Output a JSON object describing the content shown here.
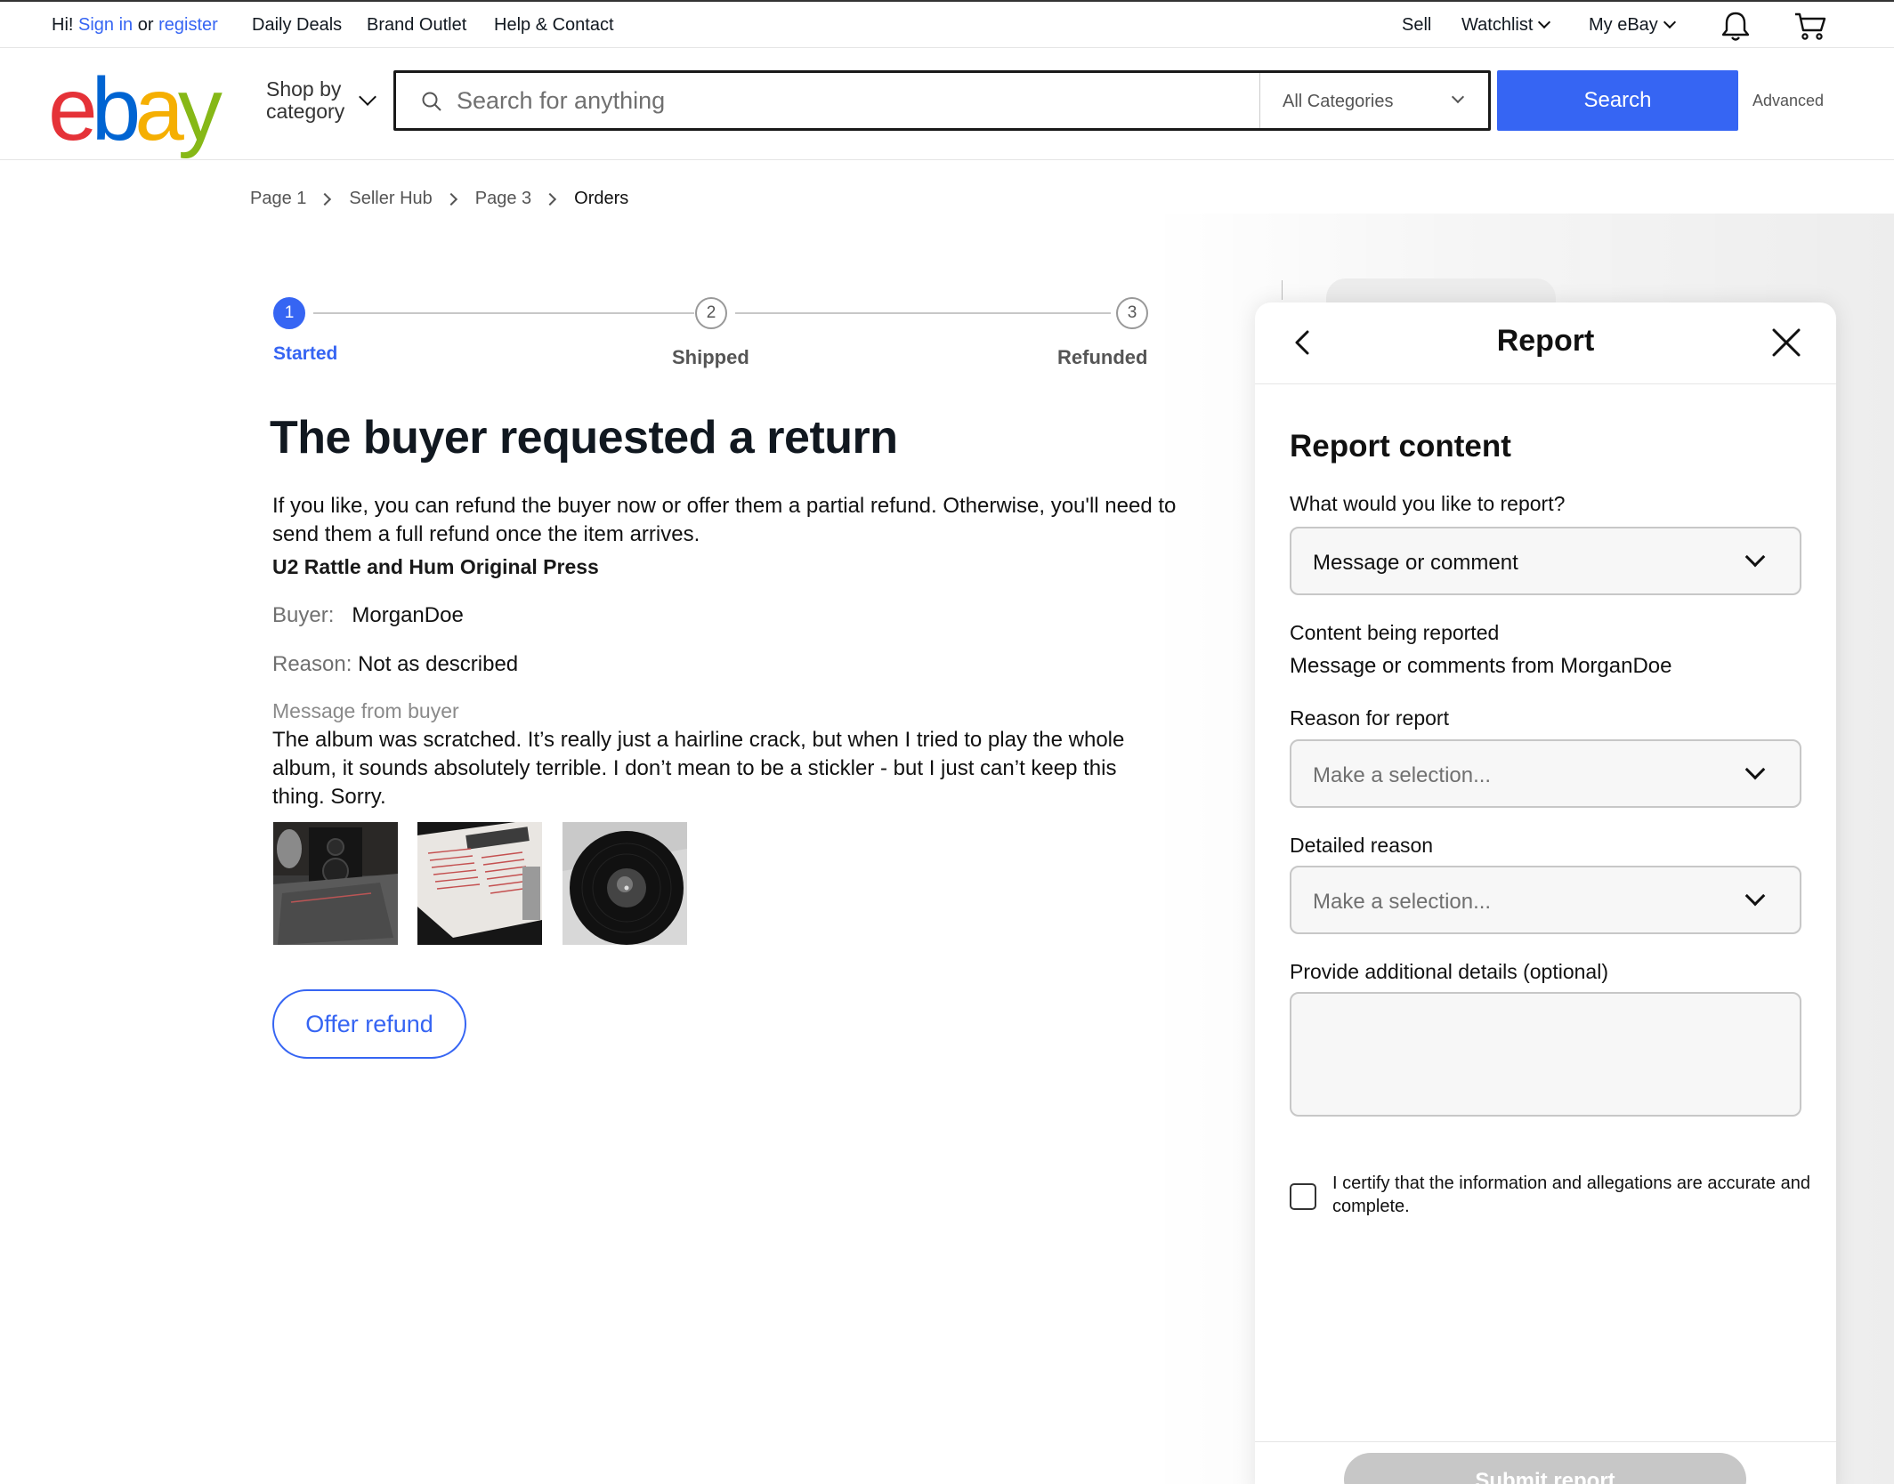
{
  "topbar": {
    "greeting": "Hi!",
    "sign_in": "Sign in",
    "or": "or",
    "register": "register",
    "nav": [
      "Daily Deals",
      "Brand Outlet",
      "Help & Contact"
    ],
    "sell": "Sell",
    "watchlist": "Watchlist",
    "my_ebay": "My eBay",
    "icons": [
      "bell-icon",
      "cart-icon"
    ]
  },
  "header": {
    "logo_letters": [
      "e",
      "b",
      "a",
      "y"
    ],
    "logo_colors": [
      "#e53238",
      "#0064d2",
      "#f5af02",
      "#86b817"
    ],
    "shop_by_line1": "Shop by",
    "shop_by_line2": "category",
    "search_placeholder": "Search for anything",
    "category_selected": "All Categories",
    "search_button": "Search",
    "advanced": "Advanced"
  },
  "breadcrumb": [
    "Page 1",
    "Seller Hub",
    "Page 3",
    "Orders"
  ],
  "stepper": {
    "current_step": 1,
    "steps": [
      {
        "number": "1",
        "label": "Started"
      },
      {
        "number": "2",
        "label": "Shipped"
      },
      {
        "number": "3",
        "label": "Refunded"
      }
    ]
  },
  "main": {
    "title": "The buyer requested a return",
    "intro": "If you like, you can refund the buyer now or offer them a partial refund. Otherwise, you'll need to send them a full refund once the item arrives.",
    "item_title": "U2 Rattle and Hum Original Press",
    "buyer_label": "Buyer:",
    "buyer_value": "MorganDoe",
    "reason_label": "Reason:",
    "reason_value": "Not as described",
    "message_label": "Message from buyer",
    "message_text": "The album was scratched. It’s really just a hairline crack, but when I tried to play the whole album, it sounds absolutely terrible. I don’t mean to be a stickler - but I just can’t keep this thing. Sorry.",
    "offer_button": "Offer refund"
  },
  "report_panel": {
    "title": "Report",
    "heading": "Report content",
    "q_label": "What would you like to report?",
    "q_value": "Message or comment",
    "content_label": "Content being reported",
    "content_value": "Message or comments from MorganDoe",
    "reason_label": "Reason for report",
    "reason_placeholder": "Make a selection...",
    "detail_label": "Detailed reason",
    "detail_placeholder": "Make a selection...",
    "additional_label": "Provide additional details (optional)",
    "additional_value": "",
    "certify_text": "I certify that the information and allegations are accurate and complete.",
    "submit_button": "Submit report"
  },
  "colors": {
    "accent": "#3665f3",
    "text": "#111820",
    "muted": "#707070"
  }
}
